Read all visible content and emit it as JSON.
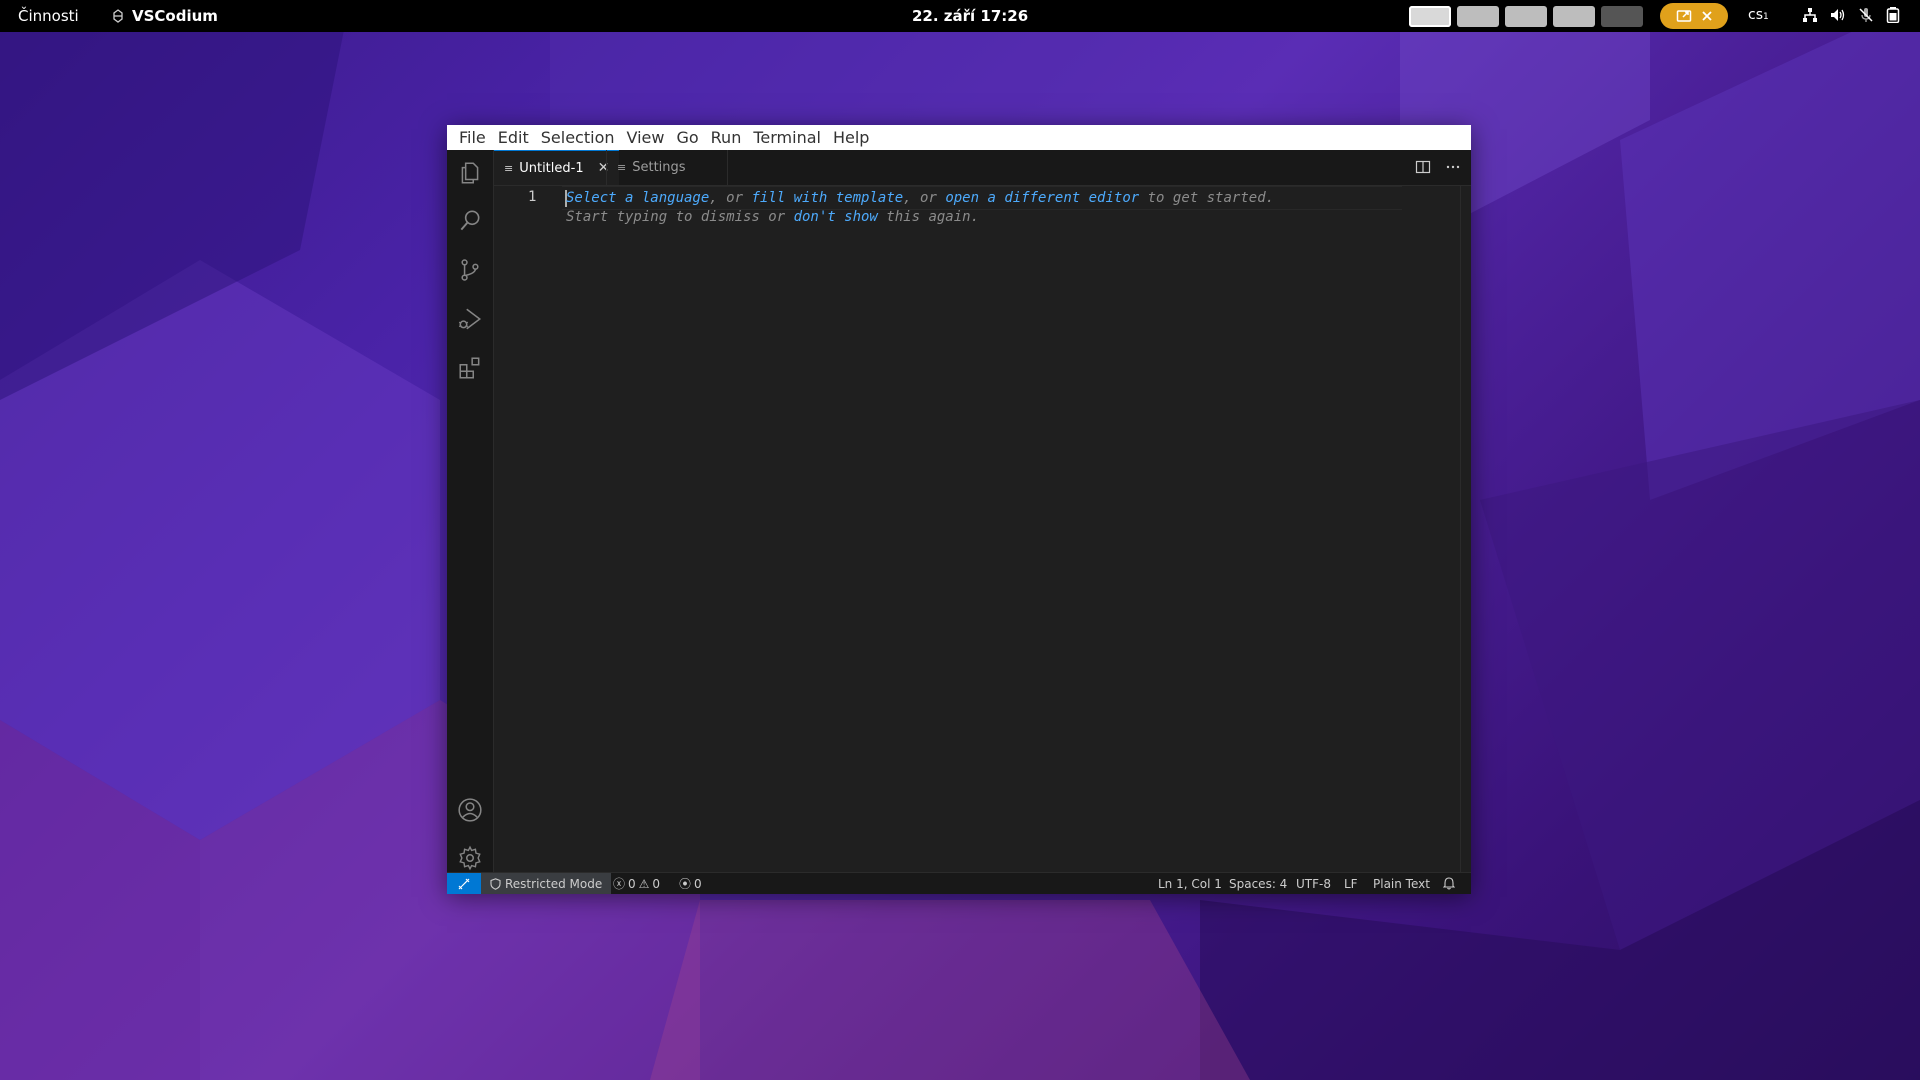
{
  "topbar": {
    "activities": "Činnosti",
    "app_name": "VSCodium",
    "clock": "22. září  17:26",
    "language": "cs",
    "workspaces": 5
  },
  "window": {
    "menu": [
      "File",
      "Edit",
      "Selection",
      "View",
      "Go",
      "Run",
      "Terminal",
      "Help"
    ],
    "activity_bar": [
      "files-icon",
      "search-icon",
      "source-control-icon",
      "run-debug-icon",
      "extensions-icon",
      "account-icon",
      "manage-gear-icon"
    ],
    "tabs": [
      {
        "label": "Untitled-1",
        "active": true
      },
      {
        "label": "Settings",
        "active": false
      }
    ],
    "editor": {
      "line_number": "1",
      "hint": {
        "l1_a": "Select a language",
        "l1_b": ", or ",
        "l1_c": "fill with template",
        "l1_d": ", or ",
        "l1_e": "open a different editor",
        "l1_f": " to get started.",
        "l2_a": "Start typing to dismiss or ",
        "l2_b": "don't show",
        "l2_c": " this again."
      }
    },
    "statusbar": {
      "restricted": "Restricted Mode",
      "errors": "0",
      "warnings": "0",
      "ports": "0",
      "position": "Ln 1, Col 1",
      "spaces": "Spaces: 4",
      "encoding": "UTF-8",
      "eol": "LF",
      "language_mode": "Plain Text"
    }
  },
  "colors": {
    "accent": "#0078d4",
    "link": "#4daafc",
    "share_pill": "#e0a11b"
  }
}
